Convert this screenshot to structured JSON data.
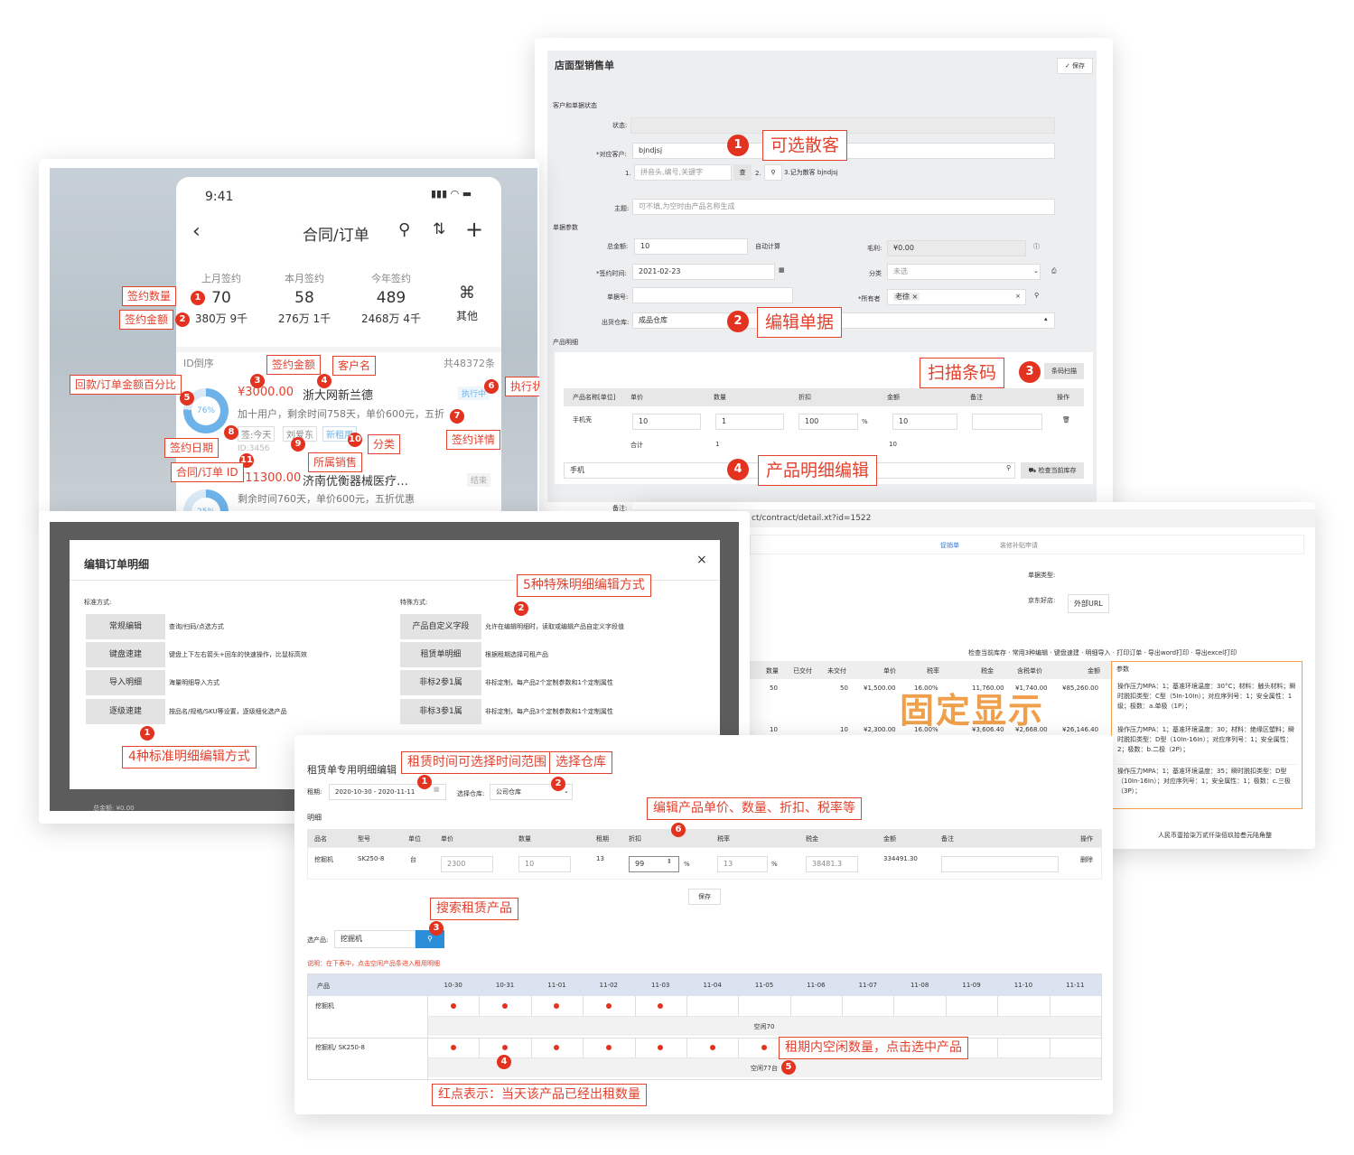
{
  "store_form": {
    "title": "店面型销售单",
    "save": "保存",
    "section_customer": "客户和单据状态",
    "status_label": "状态:",
    "customer_label": "*对应客户:",
    "customer_value": "bjndjsj",
    "search_no1": "1.",
    "search_placeholder": "拼音头,编号,关键字",
    "query_btn": "查",
    "no2": "2.",
    "walkin_note": "3.记为散客 bjndjsj",
    "subject_label": "主题:",
    "subject_placeholder": "可不填,为空时由产品名称生成",
    "section_params": "单据参数",
    "total_label": "总金额:",
    "total_value": "10",
    "auto_calc": "自动计算",
    "profit_label": "毛利:",
    "profit_value": "¥0.00",
    "sign_label": "*签约时间:",
    "sign_value": "2021-02-23",
    "category_label": "分类",
    "category_value": "未选",
    "docno_label": "单据号:",
    "owner_label": "*所有者",
    "owner_value": "老徐 ×",
    "owner_x": "×",
    "warehouse_label": "出货仓库:",
    "warehouse_value": "成品仓库",
    "section_products": "产品明细",
    "barcode_btn": "条码扫描",
    "cols": [
      "产品名称[单位]",
      "单价",
      "数量",
      "折扣",
      "金额",
      "备注",
      "操作"
    ],
    "row_name": "手机壳",
    "row_price": "10",
    "row_qty": "1",
    "row_discount": "100",
    "row_pct": "%",
    "row_amount": "10",
    "total_row_label": "合计",
    "total_qty": "1",
    "total_amount": "10",
    "search_product": "手机",
    "check_stock_btn": "检查当前库存",
    "remark_label": "备注:",
    "ann1": "可选散客",
    "ann2": "编辑单据",
    "ann3": "扫描条码",
    "ann4": "产品明细编辑",
    "n1": "1",
    "n2": "2",
    "n3": "3",
    "n4": "4"
  },
  "mobile": {
    "time": "9:41",
    "title": "合同/订单",
    "stats": [
      {
        "label": "上月签约",
        "count": "70",
        "amount": "380万 9千"
      },
      {
        "label": "本月签约",
        "count": "58",
        "amount": "276万 1千"
      },
      {
        "label": "今年签约",
        "count": "489",
        "amount": "2468万 4千"
      }
    ],
    "other": "其他",
    "sort": "ID倒序",
    "total": "共48372条",
    "o1": {
      "amount": "¥3000.00",
      "customer": "浙大网新兰德",
      "desc": "加十用户，剩余时间758天，单价600元，五折",
      "tag_date": "签:今天",
      "tag_sales": "刘爱东",
      "tag_cat": "新租用",
      "status": "执行中",
      "id": "ID:3456",
      "pct": "76%"
    },
    "o2": {
      "amount": "¥11300.00",
      "customer": "济南优衡器械医疗…",
      "desc": "剩余时间760天，单价600元，五折优惠",
      "status": "结束",
      "pct": "25%"
    },
    "labels": {
      "sign_count": "签约数量",
      "sign_amount": "签约金额",
      "amount": "签约金额",
      "customer": "客户名",
      "percent": "回款/订单金额百分比",
      "status": "执行状",
      "date": "签约日期",
      "detail": "签约详情",
      "sales": "所属销售",
      "category": "分类",
      "id": "合同/订单 ID"
    },
    "nums": [
      "1",
      "2",
      "3",
      "4",
      "5",
      "6",
      "7",
      "8",
      "9",
      "10",
      "11"
    ]
  },
  "detail": {
    "url": "ct/contract/detail.xt?id=1522",
    "tab1": "促销单",
    "tab2": "装修补贴申请",
    "doctype_label": "单据类型:",
    "shop_label": "京东好店:",
    "ext_url": "外部URL",
    "toolbar": [
      "检查当前库存",
      "常用3种编辑",
      "键盘速建",
      "明细导入",
      "打印订单",
      "导出word打印",
      "导出excel打印"
    ],
    "cols": [
      "数量",
      "已交付",
      "未交付",
      "单价",
      "税率",
      "税金",
      "含税单价",
      "金额",
      "参数"
    ],
    "r1": {
      "qty": "50",
      "undelivered": "50",
      "price": "¥1,500.00",
      "tax": "16.00%",
      "taxamt": "11,760.00",
      "taxprice": "¥1,740.00",
      "amount": "¥85,260.00"
    },
    "r2": {
      "qty": "10",
      "undelivered": "10",
      "price": "¥2,300.00",
      "tax": "16.00%",
      "taxamt": "¥3,606.40",
      "taxprice": "¥2,668.00",
      "amount": "¥26,146.40"
    },
    "params": [
      "操作压力MPA：1；基准环境温度：30°C；材料：触头材料；瞬时脱扣类型：C型（5In-10In）；对应序列号：1；安全属性：1级；极数：a.单极（1P）；",
      "操作压力MPA：1；基准环境温度：30；材料：绝缘区塑料；瞬时脱扣类型：D型（10In-16In）；对应序列号：1；安全属性：2；极数：b.二极（2P）；",
      "操作压力MPA：1；基准环境温度：35；瞬时脱扣类型：D型（10In-16In）；对应序列号：1；安全属性：1；极数：c.三极（3P）；"
    ],
    "fixed": "固定显示",
    "total_cn": "人民币壹拾柒万贰仟柒佰玖拾叁元陆角整"
  },
  "edit_modal": {
    "title": "编辑订单明细",
    "close": "×",
    "std_title": "标准方式:",
    "special_title": "特殊方式:",
    "std": [
      {
        "btn": "常规编辑",
        "desc": "查询/扫码/点选方式"
      },
      {
        "btn": "键盘速建",
        "desc": "键盘上下左右箭头+回车的快速操作，比鼠标高效"
      },
      {
        "btn": "导入明细",
        "desc": "海量明细导入方式"
      },
      {
        "btn": "逐级速建",
        "desc": "按品名/规格/SKU等设置，逐级细化选产品"
      }
    ],
    "special": [
      {
        "btn": "产品自定义字段",
        "desc": "允许在编辑明细时，读取或编辑产品自定义字段值"
      },
      {
        "btn": "租赁单明细",
        "desc": "根据租期选择可租产品"
      },
      {
        "btn": "非标2参1属",
        "desc": "非标定制，每产品2个定制参数和1个定制属性"
      },
      {
        "btn": "非标3参1属",
        "desc": "非标定制，每产品3个定制参数和1个定制属性"
      }
    ],
    "ann_special": "5种特殊明细编辑方式",
    "ann_std": "4种标准明细编辑方式",
    "n1": "1",
    "n2": "2",
    "footer_total": "总金额:",
    "footer_val": "¥0.00"
  },
  "rental": {
    "title": "租赁单专用明细编辑",
    "period_label": "租期:",
    "period_value": "2020-10-30 - 2020-11-11",
    "wh_label": "选择仓库:",
    "wh_value": "公司仓库",
    "detail_label": "明细",
    "cols": [
      "品名",
      "型号",
      "单位",
      "单价",
      "数量",
      "租期",
      "折扣",
      "税率",
      "税金",
      "金额",
      "备注",
      "操作"
    ],
    "row": {
      "name": "挖掘机",
      "model": "SK250-8",
      "unit": "台",
      "price": "2300",
      "qty": "10",
      "period": "13",
      "discount": "99",
      "pct": "%",
      "tax": "13",
      "pct2": "%",
      "taxamt": "38481.3",
      "amount": "334491.30",
      "op": "删除"
    },
    "save": "保存",
    "select_label": "选产品:",
    "select_value": "挖掘机",
    "note": "说明：在下表中，点击空闲产品条进入租用明细",
    "cal_head": "产品",
    "dates": [
      "10-30",
      "10-31",
      "11-01",
      "11-02",
      "11-03",
      "11-04",
      "11-05",
      "11-06",
      "11-07",
      "11-08",
      "11-09",
      "11-10",
      "11-11"
    ],
    "p1": "挖掘机",
    "p1_free": "空闲70",
    "p2": "挖掘机/ SK250-8",
    "p2_free": "空闲77台",
    "ann1": "租赁时间可选择时间范围",
    "ann2": "选择仓库",
    "ann3": "搜索租赁产品",
    "ann5": "租期内空闲数量，点击选中产品",
    "ann6": "编辑产品单价、数量、折扣、税率等",
    "ann4": "红点表示：当天该产品已经出租数量",
    "nums": [
      "1",
      "2",
      "3",
      "4",
      "5",
      "6"
    ]
  }
}
